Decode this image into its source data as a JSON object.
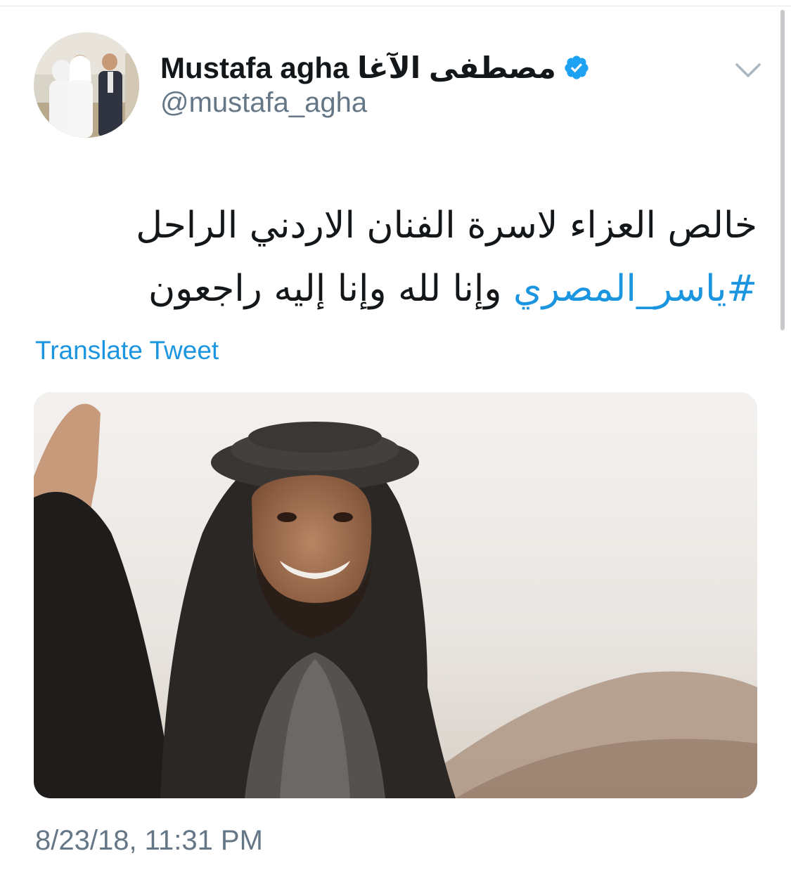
{
  "author": {
    "display_name": "Mustafa agha مصطفى الآغا",
    "handle": "@mustafa_agha",
    "verified": true,
    "avatar_icon": "profile-photo"
  },
  "tweet": {
    "line1": "خالص العزاء لاسرة الفنان الاردني الراحل",
    "hashtag": "#ياسر_المصري",
    "line2_rest": " وإنا لله وإنا إليه راجعون",
    "translate_label": "Translate Tweet",
    "timestamp": "8/23/18, 11:31 PM"
  },
  "media": {
    "description_icon": "photo"
  },
  "colors": {
    "link": "#1b95e0",
    "text": "#14171a",
    "secondary": "#657786",
    "verified": "#1da1f2"
  },
  "icons": {
    "verified": "verified-badge-icon",
    "more": "chevron-down-icon"
  }
}
